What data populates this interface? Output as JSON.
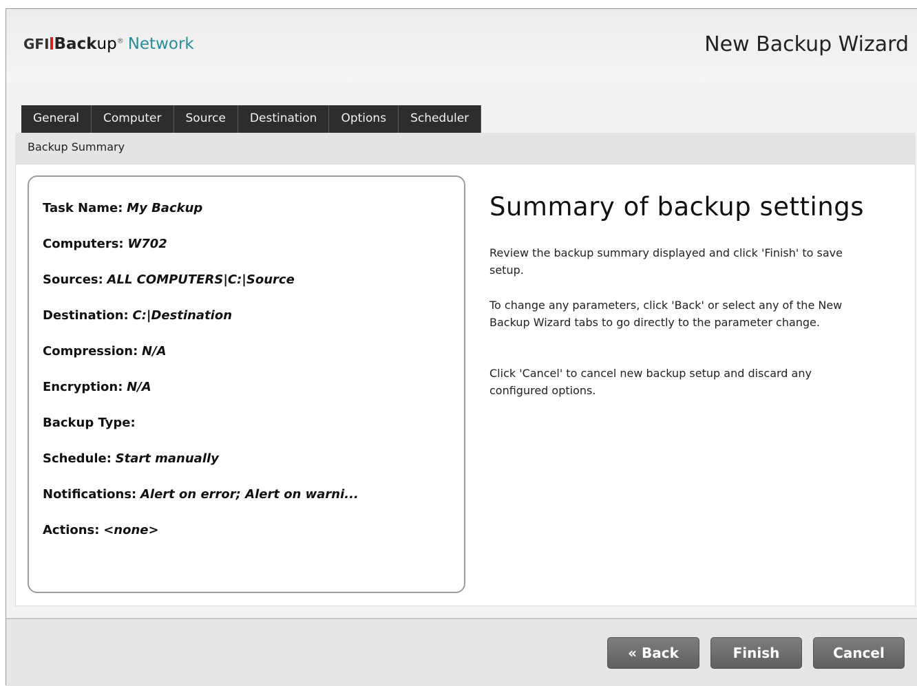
{
  "header": {
    "logo": {
      "gfi": "GFI",
      "backup": "Back",
      "up": "up",
      "reg": "®",
      "network": "Network"
    },
    "title": "New Backup Wizard"
  },
  "tabs": [
    "General",
    "Computer",
    "Source",
    "Destination",
    "Options",
    "Scheduler"
  ],
  "subheader": "Backup Summary",
  "summary": [
    {
      "label": "Task Name:",
      "value": "My Backup"
    },
    {
      "label": "Computers:",
      "value": "W702"
    },
    {
      "label": "Sources:",
      "value": "ALL COMPUTERS|C:|Source"
    },
    {
      "label": "Destination:",
      "value": "C:|Destination"
    },
    {
      "label": "Compression:",
      "value": "N/A"
    },
    {
      "label": "Encryption:",
      "value": "N/A"
    },
    {
      "label": "Backup Type:",
      "value": ""
    },
    {
      "label": "Schedule:",
      "value": "Start manually"
    },
    {
      "label": "Notifications:",
      "value": "Alert on error; Alert on warni..."
    },
    {
      "label": "Actions:",
      "value": "<none>"
    }
  ],
  "info": {
    "heading": "Summary of backup settings",
    "p1": "Review the backup summary displayed and click 'Finish' to save setup.",
    "p2": "To change any parameters, click 'Back' or select any of the New Backup Wizard tabs to go directly to the parameter change.",
    "p3": "Click 'Cancel' to cancel new backup setup and discard any configured options."
  },
  "buttons": {
    "back": "« Back",
    "finish": "Finish",
    "cancel": "Cancel"
  }
}
